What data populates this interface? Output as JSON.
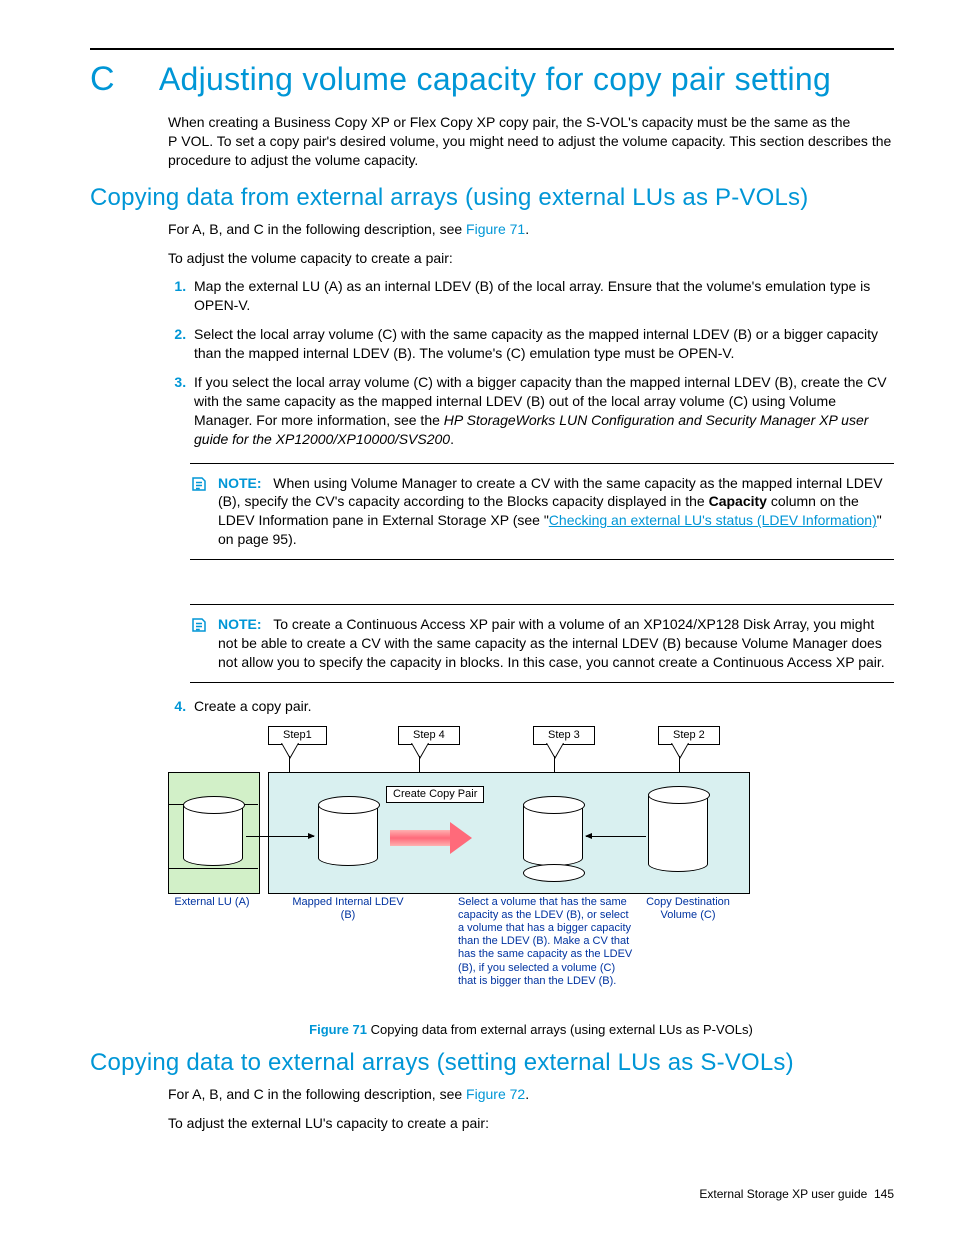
{
  "appendix_letter": "C",
  "appendix_title": "Adjusting volume capacity for copy pair setting",
  "intro": "When creating a Business Copy XP or Flex Copy XP copy pair, the S-VOL's capacity must be the same as the P VOL. To set a copy pair's desired volume, you might need to adjust the volume capacity. This section describes the procedure to adjust the volume capacity.",
  "section1": {
    "title": "Copying data from external arrays (using external LUs as P-VOLs)",
    "line1_pre": "For A, B, and C in the following description, see ",
    "line1_link": "Figure 71",
    "line1_post": ".",
    "line2": "To adjust the volume capacity to create a pair:",
    "steps": {
      "s1": "Map the external LU (A) as an internal LDEV (B) of the local array. Ensure that the volume's emulation type is OPEN-V.",
      "s2": "Select the local array volume (C) with the same capacity as the mapped internal LDEV (B) or a bigger capacity than the mapped internal LDEV (B). The volume's (C) emulation type must be OPEN-V.",
      "s3_a": "If you select the local array volume (C) with a bigger capacity than the mapped internal LDEV (B), create the CV with the same capacity as the mapped internal LDEV (B) out of the local array volume (C) using Volume Manager. For more information, see the ",
      "s3_i": "HP StorageWorks LUN Configuration and Security Manager XP user guide for the XP12000/XP10000/SVS200",
      "s3_b": ".",
      "s4": "Create a copy pair."
    },
    "note1": {
      "label": "NOTE:",
      "a": "When using Volume Manager to create a CV with the same capacity as the mapped internal LDEV (B), specify the CV's capacity according to the Blocks capacity displayed in the ",
      "bold": "Capacity",
      "b": " column on the LDEV Information pane in External Storage XP (see \"",
      "link": "Checking an external LU's status (LDEV Information)",
      "c": "\" on page 95)."
    },
    "note2": {
      "label": "NOTE:",
      "text": "To create a Continuous Access XP pair with a volume of an XP1024/XP128 Disk Array, you might not be able to create a CV with the same capacity as the internal LDEV (B) because Volume Manager does not allow you to specify the capacity in blocks. In this case, you cannot create a Continuous Access XP pair."
    },
    "figure": {
      "num": "Figure 71",
      "caption": " Copying data from external arrays (using external LUs as P-VOLs)",
      "step1": "Step1",
      "step2": "Step 2",
      "step3": "Step 3",
      "step4": "Step 4",
      "create_pair": "Create Copy Pair",
      "label_a": "External LU (A)",
      "label_b": "Mapped Internal LDEV (B)",
      "label_c_title": "Copy Destination Volume (C)",
      "label_mid": "Select a volume that has the same capacity as the LDEV (B), or select a volume that has a bigger capacity than the LDEV (B). Make a CV that has the same capacity as the LDEV (B), if you selected a volume (C) that is bigger than the LDEV (B)."
    }
  },
  "section2": {
    "title": "Copying data to external arrays (setting external LUs as S-VOLs)",
    "line1_pre": "For A, B, and C in the following description, see ",
    "line1_link": "Figure 72",
    "line1_post": ".",
    "line2": "To adjust the external LU's capacity to create a pair:"
  },
  "footer": {
    "doc": "External Storage XP user guide",
    "page": "145"
  }
}
